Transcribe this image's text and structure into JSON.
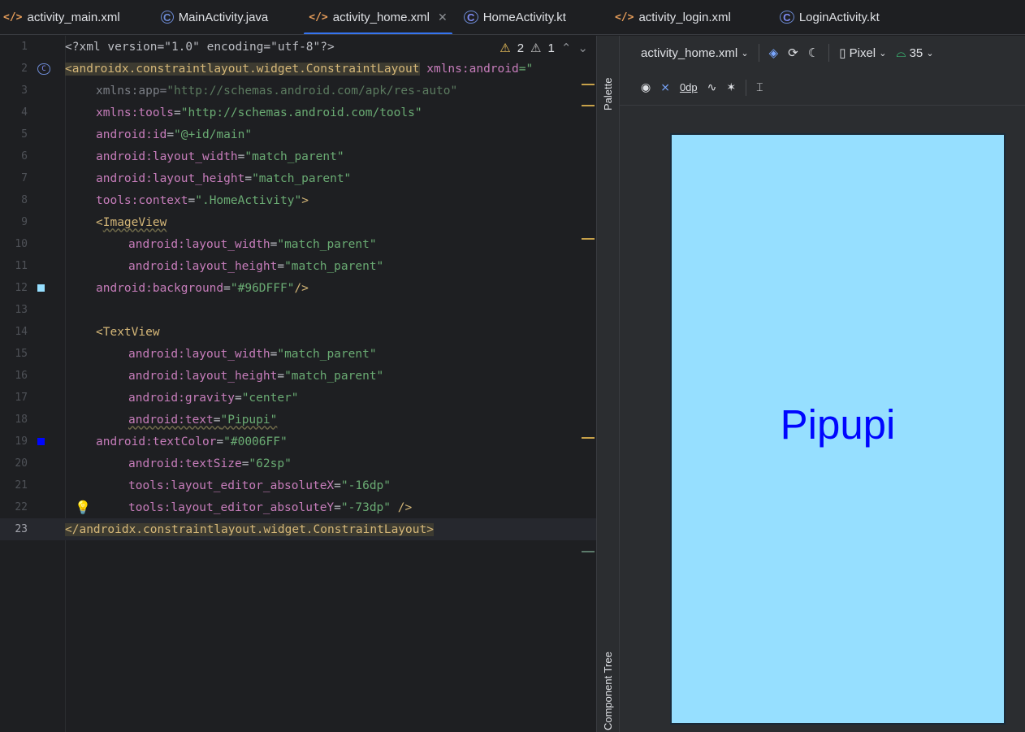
{
  "tabs": [
    {
      "label": "activity_main.xml",
      "icon": "xml-file-icon",
      "active": false
    },
    {
      "label": "MainActivity.java",
      "icon": "java-class-icon",
      "active": false
    },
    {
      "label": "activity_home.xml",
      "icon": "xml-file-icon",
      "active": true
    },
    {
      "label": "HomeActivity.kt",
      "icon": "kotlin-class-icon",
      "active": false
    },
    {
      "label": "activity_login.xml",
      "icon": "xml-file-icon",
      "active": false
    },
    {
      "label": "LoginActivity.kt",
      "icon": "kotlin-class-icon",
      "active": false
    }
  ],
  "editor": {
    "warnings": {
      "weak_count": "2",
      "strong_count": "1"
    },
    "current_line": "23",
    "line_numbers": [
      "1",
      "2",
      "3",
      "4",
      "5",
      "6",
      "7",
      "8",
      "9",
      "10",
      "11",
      "12",
      "13",
      "14",
      "15",
      "16",
      "17",
      "18",
      "19",
      "20",
      "21",
      "22",
      "23"
    ]
  },
  "code": {
    "l1": {
      "a": "<?xml version=\"1.0\" encoding=\"utf-8\"?>"
    },
    "l2": {
      "tag": "<androidx.constraintlayout.widget.ConstraintLayout",
      "attr": " xmlns:android",
      "rest": "=\""
    },
    "l3": {
      "attr": "xmlns:app",
      "eq": "=",
      "val": "\"http://schemas.android.com/apk/res-auto\""
    },
    "l4": {
      "attr": "xmlns:tools",
      "eq": "=",
      "val": "\"http://schemas.android.com/tools\""
    },
    "l5": {
      "attr": "android:id",
      "eq": "=",
      "val": "\"@+id/main\""
    },
    "l6": {
      "attr": "android:layout_width",
      "eq": "=",
      "val": "\"match_parent\""
    },
    "l7": {
      "attr": "android:layout_height",
      "eq": "=",
      "val": "\"match_parent\""
    },
    "l8": {
      "attr": "tools:context",
      "eq": "=",
      "val": "\".HomeActivity\"",
      "close": ">"
    },
    "l9": {
      "lt": "<",
      "tag": "ImageView"
    },
    "l10": {
      "attr": "android:layout_width",
      "eq": "=",
      "val": "\"match_parent\""
    },
    "l11": {
      "attr": "android:layout_height",
      "eq": "=",
      "val": "\"match_parent\""
    },
    "l12": {
      "attr": "android:background",
      "eq": "=",
      "val": "\"#96DFFF\"",
      "close": "/>"
    },
    "l14": {
      "tag": "<TextView"
    },
    "l15": {
      "attr": "android:layout_width",
      "eq": "=",
      "val": "\"match_parent\""
    },
    "l16": {
      "attr": "android:layout_height",
      "eq": "=",
      "val": "\"match_parent\""
    },
    "l17": {
      "attr": "android:gravity",
      "eq": "=",
      "val": "\"center\""
    },
    "l18": {
      "attr": "android:text",
      "eq": "=",
      "val": "\"Pipupi\""
    },
    "l19": {
      "attr": "android:textColor",
      "eq": "=",
      "val": "\"#0006FF\""
    },
    "l20": {
      "attr": "android:textSize",
      "eq": "=",
      "val": "\"62sp\""
    },
    "l21": {
      "attr": "tools:layout_editor_absoluteX",
      "eq": "=",
      "val": "\"-16dp\""
    },
    "l22": {
      "attr": "tools:layout_editor_absoluteY",
      "eq": "=",
      "val": "\"-73dp\"",
      "close": " />"
    },
    "l23": {
      "tag": "</androidx.constraintlayout.widget.ConstraintLayout>"
    }
  },
  "side": {
    "palette_label": "Palette",
    "component_tree_label": "Component Tree"
  },
  "design": {
    "file_dropdown": "activity_home.xml",
    "device_dropdown": "Pixel",
    "api_dropdown": "35",
    "margin_value": "0dp",
    "preview_text": "Pipupi",
    "preview_text_color": "#0006FF",
    "preview_bg_color": "#96DFFF"
  },
  "colors": {
    "background_swatch": "#96DFFF",
    "textcolor_swatch": "#0006FF",
    "accent": "#3574f0"
  }
}
